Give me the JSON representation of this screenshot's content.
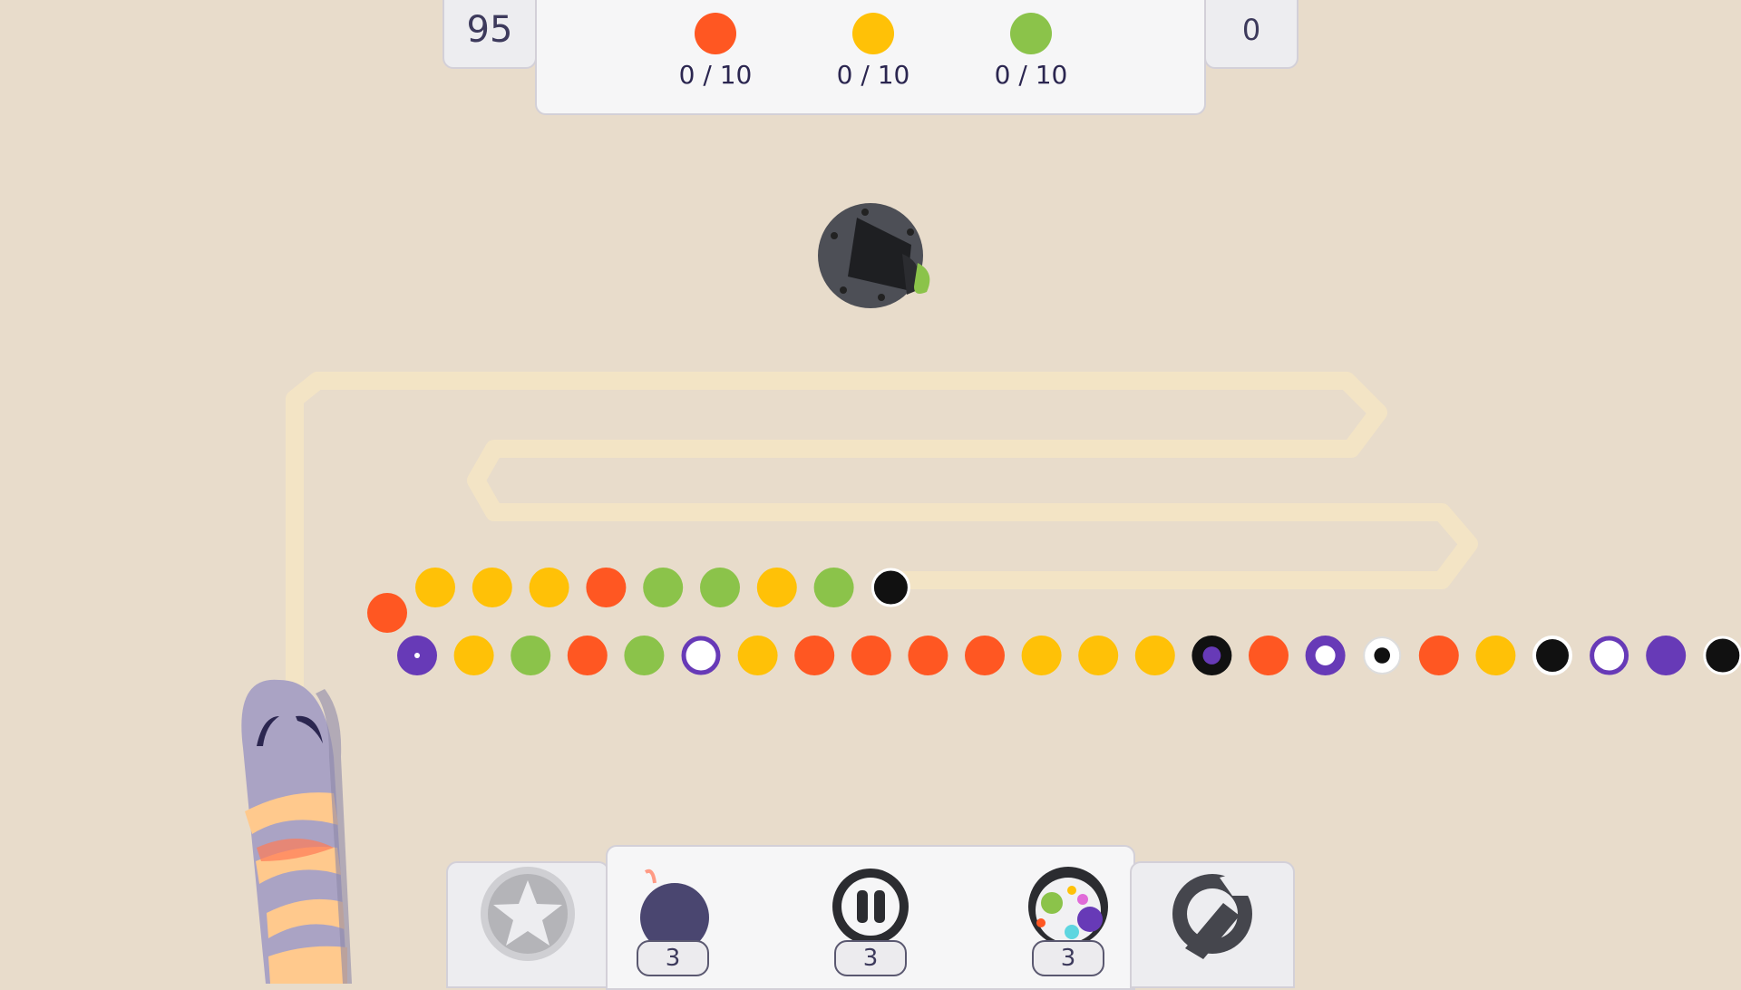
{
  "hud": {
    "left_value": "95",
    "right_value": "0"
  },
  "goals": [
    {
      "color": "#ff5722",
      "count": "0 / 10",
      "name": "orange"
    },
    {
      "color": "#ffc107",
      "count": "0 / 10",
      "name": "yellow"
    },
    {
      "color": "#8bc34a",
      "count": "0 / 10",
      "name": "green"
    }
  ],
  "cannon": {
    "loaded_ball_color": "#8bc34a"
  },
  "colors": {
    "orange": "#ff5722",
    "yellow": "#ffc107",
    "green": "#8bc34a",
    "purple": "#673ab7",
    "black": "#111111",
    "white": "#ffffff",
    "background": "#e8dccb",
    "track": "#f4e4c4"
  },
  "upper_chain": [
    "orange",
    "yellow",
    "yellow",
    "yellow",
    "orange",
    "green",
    "green",
    "yellow",
    "green",
    "black"
  ],
  "lower_chain": [
    "purple-dot",
    "yellow",
    "green",
    "orange",
    "green",
    "white-ring",
    "yellow",
    "orange",
    "orange",
    "orange",
    "orange",
    "yellow",
    "yellow",
    "yellow",
    "black-purple",
    "orange",
    "purple-ring",
    "white-black",
    "orange",
    "yellow",
    "black-ring",
    "white-ring",
    "purple",
    "black"
  ],
  "powerups": [
    {
      "name": "bomb",
      "icon": "bomb-icon",
      "count": "3"
    },
    {
      "name": "pause",
      "icon": "pause-icon",
      "count": "3"
    },
    {
      "name": "rainbow",
      "icon": "rainbow-ball-icon",
      "count": "3"
    }
  ],
  "bottom_buttons": {
    "left_icon": "star-icon",
    "right_icon": "wrench-icon"
  }
}
